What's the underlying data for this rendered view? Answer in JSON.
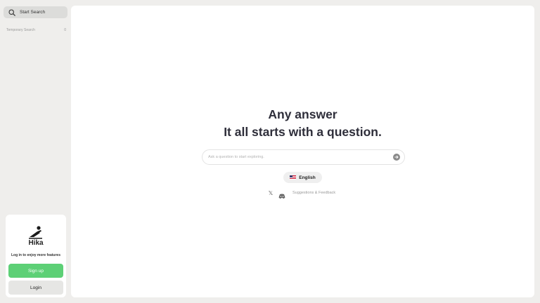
{
  "sidebar": {
    "search_label": "Start Search",
    "temporary_search": {
      "label": "Temporary Search",
      "count": "0"
    },
    "login_card": {
      "brand_name": "Hika",
      "prompt": "Log in to enjoy more features",
      "signup_label": "Sign up",
      "login_label": "Login"
    }
  },
  "main": {
    "headline_line1": "Any answer",
    "headline_line2": "It all starts with a question.",
    "ask_placeholder": "Ask a question to start exploring.",
    "language_label": "English",
    "feedback_label": "Suggestions & Feedback"
  },
  "icons": {
    "search": "search-icon",
    "send": "arrow-right-icon",
    "flag": "us-flag-icon",
    "x": "x-logo-icon",
    "discord": "discord-icon",
    "logo": "hika-logo-icon"
  },
  "colors": {
    "background": "#efeeec",
    "panel": "#ffffff",
    "signup": "#5dd076",
    "headline": "#2e2e3a"
  }
}
